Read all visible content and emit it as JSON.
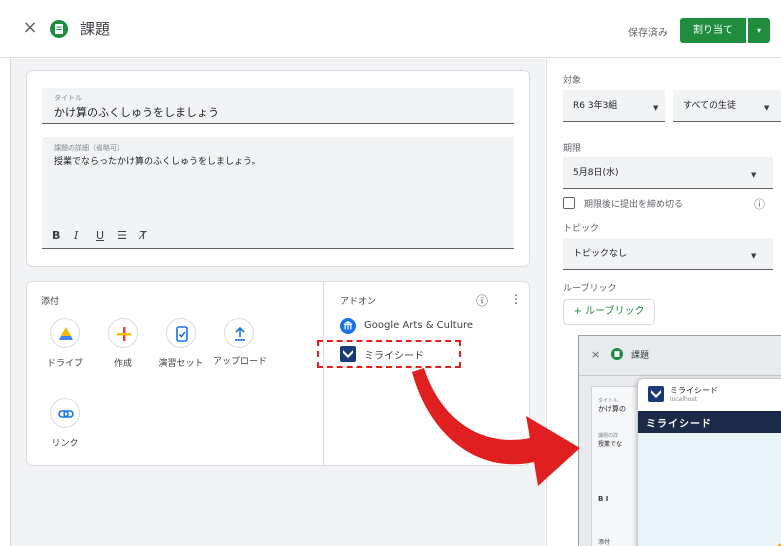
{
  "header": {
    "close_label": "×",
    "title": "課題",
    "saved_label": "保存済み",
    "assign_label": "割り当て",
    "caret": "▾"
  },
  "form": {
    "title_label": "タイトル",
    "title_value": "かけ算のふくしゅうをしましょう",
    "detail_label": "課題の詳細（省略可）",
    "detail_value": "授業でならったかけ算のふくしゅうをしましょう。",
    "format_bold": "B",
    "format_italic": "I",
    "format_underline": "U",
    "format_list": "☰",
    "format_clear": "T̸"
  },
  "attachments": {
    "label": "添付",
    "items": [
      {
        "label": "ドライブ",
        "icon": "drive-icon"
      },
      {
        "label": "作成",
        "icon": "plus-icon"
      },
      {
        "label": "演習セット",
        "icon": "practice-set-icon"
      },
      {
        "label": "アップロード",
        "icon": "upload-icon"
      },
      {
        "label": "リンク",
        "icon": "link-icon"
      }
    ]
  },
  "addons": {
    "label": "アドオン",
    "info": "ⓘ",
    "more": "⋮",
    "items": [
      {
        "label": "Google Arts & Culture",
        "icon": "arts-culture-icon"
      },
      {
        "label": "ミライシード",
        "icon": "miraiseed-icon"
      }
    ]
  },
  "sidebar": {
    "target_label": "対象",
    "class_value": "R6 3年3組",
    "students_value": "すべての生徒",
    "due_label": "期限",
    "due_value": "5月8日(水)",
    "close_after_due": "期限後に提出を締め切る",
    "topic_label": "トピック",
    "topic_value": "トピックなし",
    "rubric_label": "ルーブリック",
    "rubric_button": "+ ルーブリック"
  },
  "inset": {
    "close_label": "×",
    "title": "課題",
    "popup_name": "ミライシード",
    "popup_host": "localhost",
    "banner": "ミライシード",
    "field_label1": "タイトル",
    "field_value1": "かけ算の",
    "field_label2": "課題の詳",
    "field_value2": "授業でな",
    "fmt": "B  I",
    "bottom_label": "添付"
  },
  "colors": {
    "brand_green": "#1e8e3e",
    "arrow_red": "#e02020",
    "highlight_border": "#e02020"
  }
}
